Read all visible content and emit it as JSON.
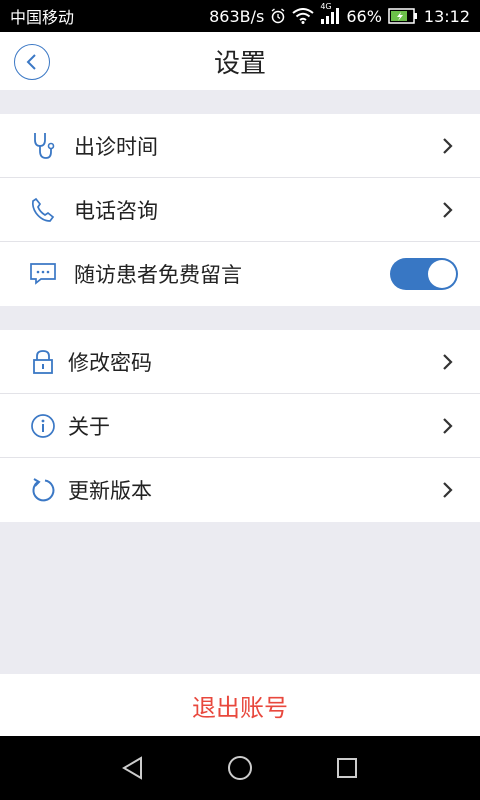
{
  "status_bar": {
    "carrier": "中国移动",
    "net_speed": "863B/s",
    "network_type": "4G",
    "battery": "66%",
    "time": "13:12"
  },
  "header": {
    "title": "设置",
    "back_icon": "back-chevron-circle-icon"
  },
  "settings_group1": [
    {
      "label": "出诊时间",
      "icon": "stethoscope-icon"
    },
    {
      "label": "电话咨询",
      "icon": "phone-icon"
    },
    {
      "label": "随访患者免费留言",
      "icon": "message-icon",
      "toggle_on": true
    }
  ],
  "settings_group2": [
    {
      "label": "修改密码",
      "icon": "lock-icon"
    },
    {
      "label": "关于",
      "icon": "info-icon"
    },
    {
      "label": "更新版本",
      "icon": "refresh-icon"
    }
  ],
  "logout": {
    "label": "退出账号"
  },
  "colors": {
    "accent": "#3877c4",
    "logout_text": "#e8483d",
    "background": "#ebebf1"
  }
}
